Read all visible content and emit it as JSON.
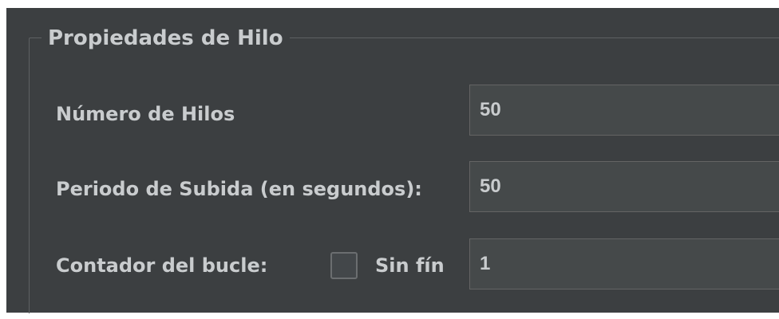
{
  "group": {
    "title": "Propiedades de Hilo"
  },
  "fields": {
    "num_threads": {
      "label": "Número de Hilos",
      "value": "50"
    },
    "ramp_up": {
      "label": "Periodo de Subida (en segundos):",
      "value": "50"
    },
    "loop_count": {
      "label": "Contador del bucle:",
      "value": "1"
    }
  },
  "infinite": {
    "label": "Sin fín",
    "checked": false
  }
}
